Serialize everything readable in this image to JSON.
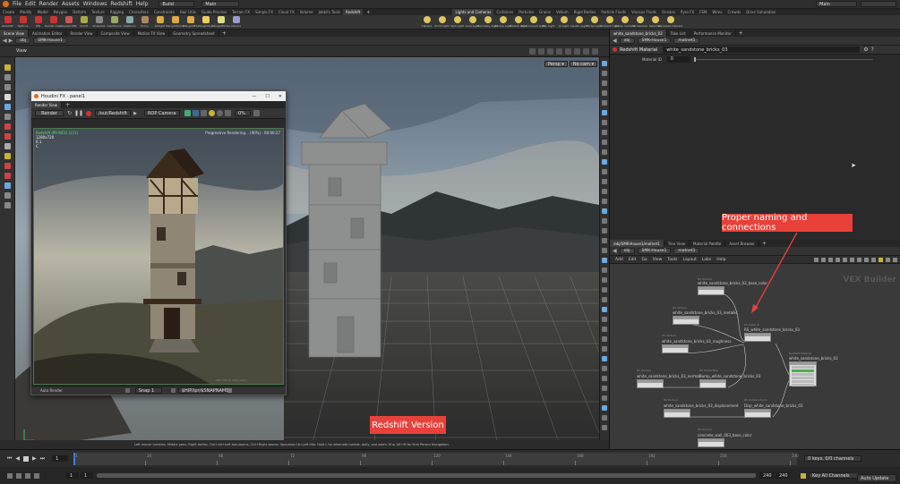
{
  "menubar": {
    "items": [
      "File",
      "Edit",
      "Render",
      "Assets",
      "Windows",
      "Redshift",
      "Help"
    ],
    "build": "Build",
    "desktop": "Main",
    "right_desktop": "Main"
  },
  "shelf": {
    "left_tabs": [
      "Create",
      "Modify",
      "Model",
      "Polygon",
      "Deform",
      "Texture",
      "Rigging",
      "Characters",
      "Constraints",
      "Hair Utils",
      "Guide Process",
      "Terrain FX",
      "Simple FX",
      "Cloud FX",
      "Volume",
      "Jobkits Tools",
      "Redshift"
    ],
    "left_active": 16,
    "left_tools": [
      "Redshift",
      "Options",
      "IPR",
      "Render View",
      "ViewportIPR",
      "OnOff",
      "Snapshot",
      "CamParms",
      "ObjParms",
      "Proxy",
      "RSLight",
      "RSLightDome",
      "RSLightIES",
      "RSLightSun",
      "RSLightPortal",
      "Volume"
    ],
    "right_tabs": [
      "Lights and Cameras",
      "Collisions",
      "Particles",
      "Grains",
      "Vellum",
      "Rigid Bodies",
      "Particle Fluids",
      "Viscous Fluids",
      "Oceans",
      "Pyro FX",
      "FEM",
      "Wires",
      "Crowds",
      "Drive Simulation"
    ],
    "right_tools": [
      "Camera",
      "Point Light",
      "Spot Light",
      "Area Light",
      "Geometry Light",
      "Volume Light",
      "Distant Light",
      "Environment Light",
      "Sky Light",
      "GI Light",
      "Caustic Light",
      "Portal Light",
      "Ambient Light",
      "Stereo Camera",
      "VR Camera",
      "Switcher",
      "Gamepad Camera"
    ]
  },
  "viewport": {
    "tabs": [
      "Scene View",
      "Animation Editor",
      "Render View",
      "Composite View",
      "Motion FX View",
      "Geometry Spreadsheet"
    ],
    "path": [
      "obj",
      "SMK-House1"
    ],
    "view_label": "View",
    "persp": "Persp ▾",
    "cam": "No cam ▾",
    "status": "Left mouse tumbles. Middle pans. Right dollies. Ctrl+Alt+Left box-zooms. Ctrl+Right zooms. Spacebar-Ctrl-Left tilts. Hold L for alternate tumble, dolly, and zoom.    M or Alt+M for First Person Navigation."
  },
  "render_window": {
    "title": "Houdini FX - panel1",
    "tab": "Render View",
    "render_btn": "Render",
    "rop": "/out/Redshift_ROP1",
    "camera": "ROP Camera",
    "zoom": "0%",
    "status": "Progressive Rendering... (90%) - 00:00:27",
    "info": [
      "Redshift IPR-9031 (211)",
      "1280x720",
      "0.1",
      "C"
    ],
    "footer": "Auto Render",
    "snap": "Snap 1",
    "file": "$HIP/ipr/$SNAPNAME",
    "note": "Left-click to drag-select"
  },
  "callouts": {
    "redshift": "Redshift Version",
    "naming": "Proper naming and connections"
  },
  "params": {
    "tabs": [
      "white_sandstone_bricks_03",
      "Take List",
      "Performance Monitor"
    ],
    "path": [
      "obj",
      "SMK-House1",
      "matnet1"
    ],
    "type": "Redshift Material",
    "name": "white_sandstone_bricks_03",
    "field_label": "Material ID",
    "field_value": "0"
  },
  "network": {
    "tabs": [
      "/obj/SMK-House1/matnet1",
      "Tree View",
      "Material Palette",
      "Asset Browser"
    ],
    "path": [
      "obj",
      "SMK-House1",
      "matnet1"
    ],
    "menu": [
      "Add",
      "Edit",
      "Go",
      "View",
      "Tools",
      "Layout",
      "Labs",
      "Help"
    ],
    "watermark": "VEX Builder",
    "nodes": [
      {
        "label": "white_sandstone_bricks_03_base_color",
        "sub": "RS Texture"
      },
      {
        "label": "white_sandstone_bricks_03_metallic",
        "sub": "RS Texture"
      },
      {
        "label": "white_sandstone_bricks_03_roughness",
        "sub": "RS Texture"
      },
      {
        "label": "RS_white_sandstone_bricks_03",
        "sub": "RS Material"
      },
      {
        "label": "white_sandstone_bricks_03",
        "sub": "Redshift Material"
      },
      {
        "label": "white_sandstone_bricks_03_normal",
        "sub": "RS Texture"
      },
      {
        "label": "Bump_white_sandstone_bricks_03",
        "sub": "RS Bump Map"
      },
      {
        "label": "white_sandstone_bricks_03_displacement",
        "sub": "RS Texture"
      },
      {
        "label": "Disp_white_sandstone_bricks_03",
        "sub": "RS Displacement"
      },
      {
        "label": "concrete_wall_003_base_color",
        "sub": "RS Texture"
      }
    ]
  },
  "timeline": {
    "ticks": [
      "1",
      "24",
      "48",
      "72",
      "96",
      "120",
      "144",
      "168",
      "192",
      "216",
      "240"
    ],
    "frame": "1",
    "start": "1",
    "start2": "1",
    "end": "240",
    "end2": "240",
    "keys": "0 keys, 0/0 channels",
    "keyall": "Key All Channels",
    "auto_update": "Auto Update"
  }
}
